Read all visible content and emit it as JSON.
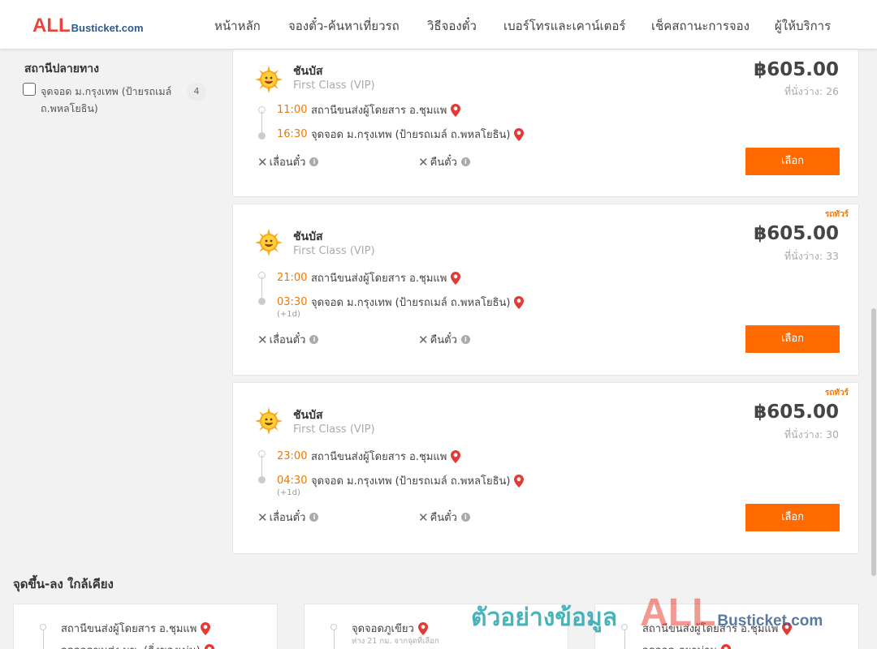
{
  "header": {
    "logo_all": "ALL",
    "logo_rest": "Busticket.com",
    "nav": [
      "หน้าหลัก",
      "จองตั๋ว-ค้นหาเที่ยวรถ",
      "วิธีจองตั๋ว",
      "เบอร์โทรและเคาน์เตอร์",
      "เช็คสถานะการจอง",
      "ผู้ให้บริการ"
    ]
  },
  "filter": {
    "title": "สถานีปลายทาง",
    "item_label": "จุดจอด ม.กรุงเทพ (ป้ายรถเมล์ ถ.พหลโยธิน)",
    "item_count": "4"
  },
  "trips": [
    {
      "hot_badge": "",
      "operator": "ชันบัส",
      "bus_class": "First Class (VIP)",
      "price": "฿605.00",
      "seats": "ที่นั่งว่าง: 26",
      "depart_time": "11:00",
      "depart_place": "สถานีขนส่งผู้โดยสาร อ.ชุมแพ",
      "arrive_time": "16:30",
      "arrive_place": "จุดจอด ม.กรุงเทพ (ป้ายรถเมล์ ถ.พหลโยธิน)",
      "plus_day": "",
      "postpone": "เลื่อนตั๋ว",
      "refund": "คืนตั๋ว",
      "select": "เลือก"
    },
    {
      "hot_badge": "รถทัวร์",
      "operator": "ชันบัส",
      "bus_class": "First Class (VIP)",
      "price": "฿605.00",
      "seats": "ที่นั่งว่าง: 33",
      "depart_time": "21:00",
      "depart_place": "สถานีขนส่งผู้โดยสาร อ.ชุมแพ",
      "arrive_time": "03:30",
      "arrive_place": "จุดจอด ม.กรุงเทพ (ป้ายรถเมล์ ถ.พหลโยธิน)",
      "plus_day": "(+1d)",
      "postpone": "เลื่อนตั๋ว",
      "refund": "คืนตั๋ว",
      "select": "เลือก"
    },
    {
      "hot_badge": "รถทัวร์",
      "operator": "ชันบัส",
      "bus_class": "First Class (VIP)",
      "price": "฿605.00",
      "seats": "ที่นั่งว่าง: 30",
      "depart_time": "23:00",
      "depart_place": "สถานีขนส่งผู้โดยสาร อ.ชุมแพ",
      "arrive_time": "04:30",
      "arrive_place": "จุดจอด ม.กรุงเทพ (ป้ายรถเมล์ ถ.พหลโยธิน)",
      "plus_day": "(+1d)",
      "postpone": "เลื่อนตั๋ว",
      "refund": "คืนตั๋ว",
      "select": "เลือก"
    }
  ],
  "nearby": {
    "title": "จุดขึ้น-ลง ใกล้เคียง",
    "cards": [
      {
        "place": "สถานีขนส่งผู้โดยสาร อ.ชุมแพ",
        "sub": "",
        "place2": "จุดจอดขนส่ง มข. (ดิ่งของเม่น)"
      },
      {
        "place": "จุดจอดภูเขียว",
        "sub": "ห่าง 21 กม. จากจุดที่เลือก",
        "place2": ""
      },
      {
        "place": "สถานีขนส่งผู้โดยสาร อ.ชุมแพ",
        "sub": "",
        "place2": "จุดจอด ภูผาม่าน"
      }
    ]
  },
  "watermark": {
    "thai": "ตัวอย่างข้อมูล",
    "all": "ALL",
    "rest": "Busticket.com"
  },
  "colors": {
    "accent": "#ff6b00",
    "time": "#f07800",
    "pin": "#e53935",
    "logo_red": "#e8463c",
    "logo_blue": "#2f5a8a"
  }
}
